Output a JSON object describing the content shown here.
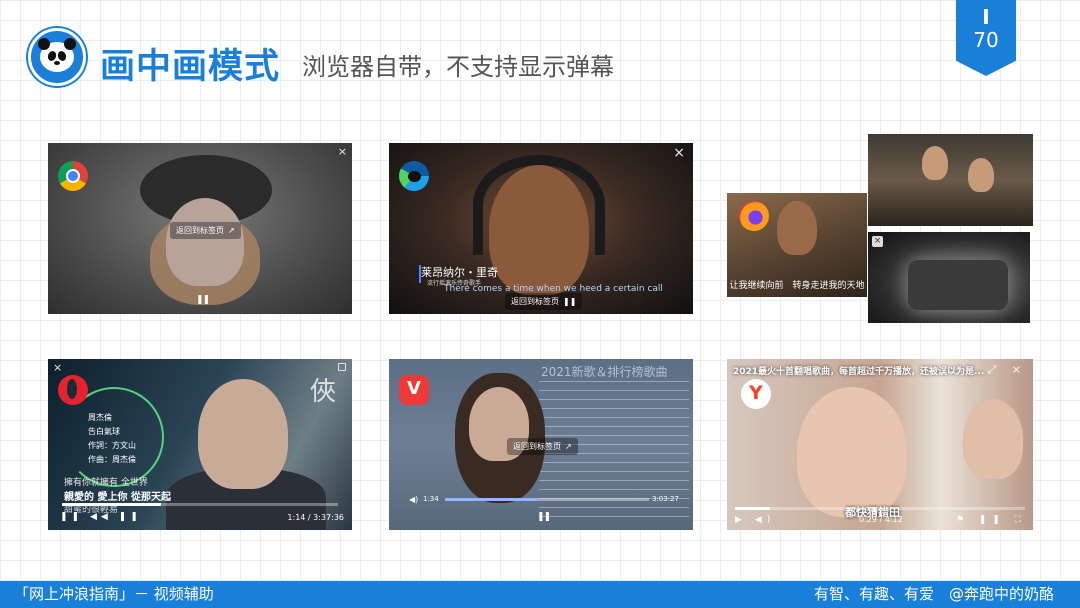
{
  "header": {
    "title": "画中画模式",
    "subtitle": "浏览器自带，不支持显示弹幕",
    "page_mark": "I",
    "page_number": "70"
  },
  "colors": {
    "brand_blue": "#1a7fd8",
    "text_gray": "#555555"
  },
  "screenshots": {
    "chrome": {
      "icon": "chrome-icon",
      "back_to_tab": "返回到标签页",
      "close": "×"
    },
    "edge": {
      "icon": "edge-icon",
      "close": "×",
      "singer_name": "莱昂纳尔・里奇",
      "singer_sub": "流行摇滚乐传奇歌手",
      "lyric_en": "There comes a time when we heed a certain call",
      "back_to_tab": "返回到标签页"
    },
    "firefox": {
      "icon": "firefox-icon",
      "subtitle": "让我继续向前　转身走进我的天地"
    },
    "opera": {
      "icon": "opera-icon",
      "close": "×",
      "credits": [
        "周杰倫",
        "告白氣球",
        "作詞：方文山",
        "作曲：周杰倫"
      ],
      "big_char": "俠",
      "lyric1": "擁有你就擁有 全世界",
      "lyric2": "親愛的 愛上你 從那天起",
      "lyric3": "甜蜜的很輕易",
      "time": "1:14 / 3:37:36",
      "progress_fraction": 0.36
    },
    "vivaldi": {
      "icon": "vivaldi-icon",
      "list_title": "2021新歌＆排行榜歌曲",
      "back_to_tab": "返回到标签页",
      "time_elapsed": "1:34",
      "time_total": "3:03:27",
      "progress_fraction": 0.45
    },
    "yandex": {
      "icon": "yandex-icon",
      "title": "2021最火十首翻唱歌曲，每首超过千万播放，还被误以为是...",
      "caption": "都快猜錯田",
      "time": "0:29 / 4:12",
      "progress_fraction": 0.12
    }
  },
  "footer": {
    "left": "「网上冲浪指南」－ 视频辅助",
    "right": "有智、有趣、有爱　@奔跑中的奶酪"
  }
}
